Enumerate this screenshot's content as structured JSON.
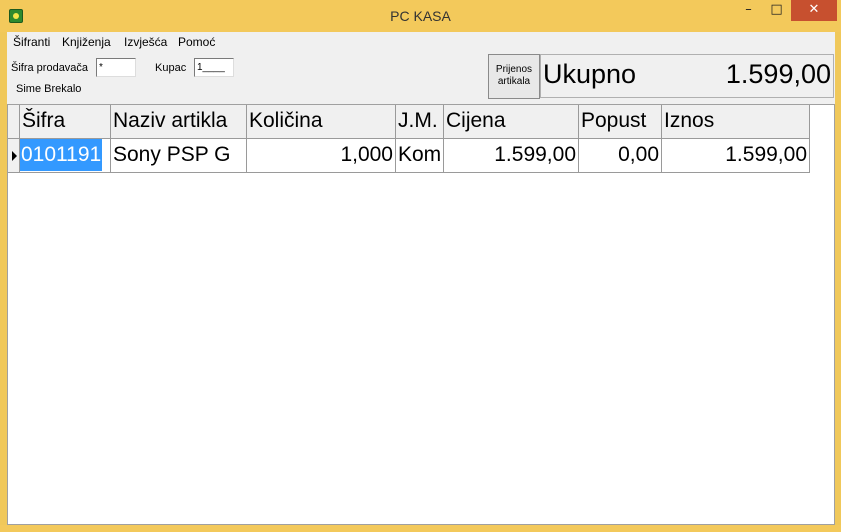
{
  "window": {
    "title": "PC KASA",
    "minimize_glyph": "–",
    "maximize_glyph": "□",
    "close_glyph": "✕",
    "icon": "app-icon"
  },
  "menu": {
    "items": [
      "Šifranti",
      "Knjiženja",
      "Izvješća",
      "Pomoć"
    ]
  },
  "toolbar": {
    "seller_label": "Šifra prodavača",
    "seller_value": "*",
    "buyer_label": "Kupac",
    "buyer_value": "1____",
    "seller_name": "Sime Brekalo",
    "transfer_button": "Prijenos artikala",
    "total_label": "Ukupno",
    "total_value": "1.599,00"
  },
  "table": {
    "columns": [
      "Šifra",
      "Naziv artikla",
      "Količina",
      "J.M.",
      "Cijena",
      "Popust",
      "Iznos"
    ],
    "rows": [
      [
        "0101191",
        "Sony PSP G",
        "1,000",
        "Kom",
        "1.599,00",
        "0,00",
        "1.599,00"
      ]
    ]
  },
  "colors": {
    "title_bar": "#f3c95b",
    "close_button": "#c7502f",
    "selection": "#3399ff"
  }
}
